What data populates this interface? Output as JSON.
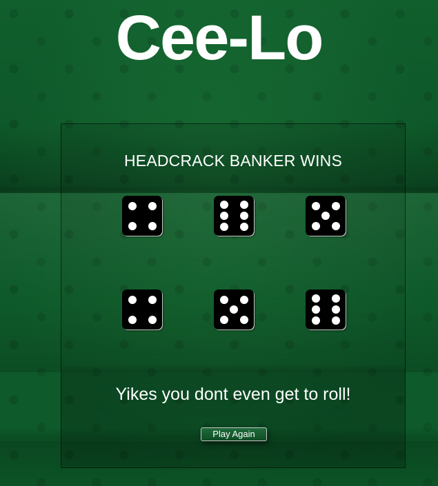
{
  "header": {
    "title": "Cee-Lo"
  },
  "game": {
    "result_title": "HEADCRACK BANKER WINS",
    "message": "Yikes you dont even get to roll!",
    "play_again_label": "Play Again",
    "banker_dice": [
      4,
      6,
      5
    ],
    "player_dice": [
      4,
      5,
      6
    ]
  },
  "colors": {
    "felt": "#0e5a2a",
    "die": "#000000",
    "pip": "#ffffff",
    "text": "#ffffff"
  }
}
